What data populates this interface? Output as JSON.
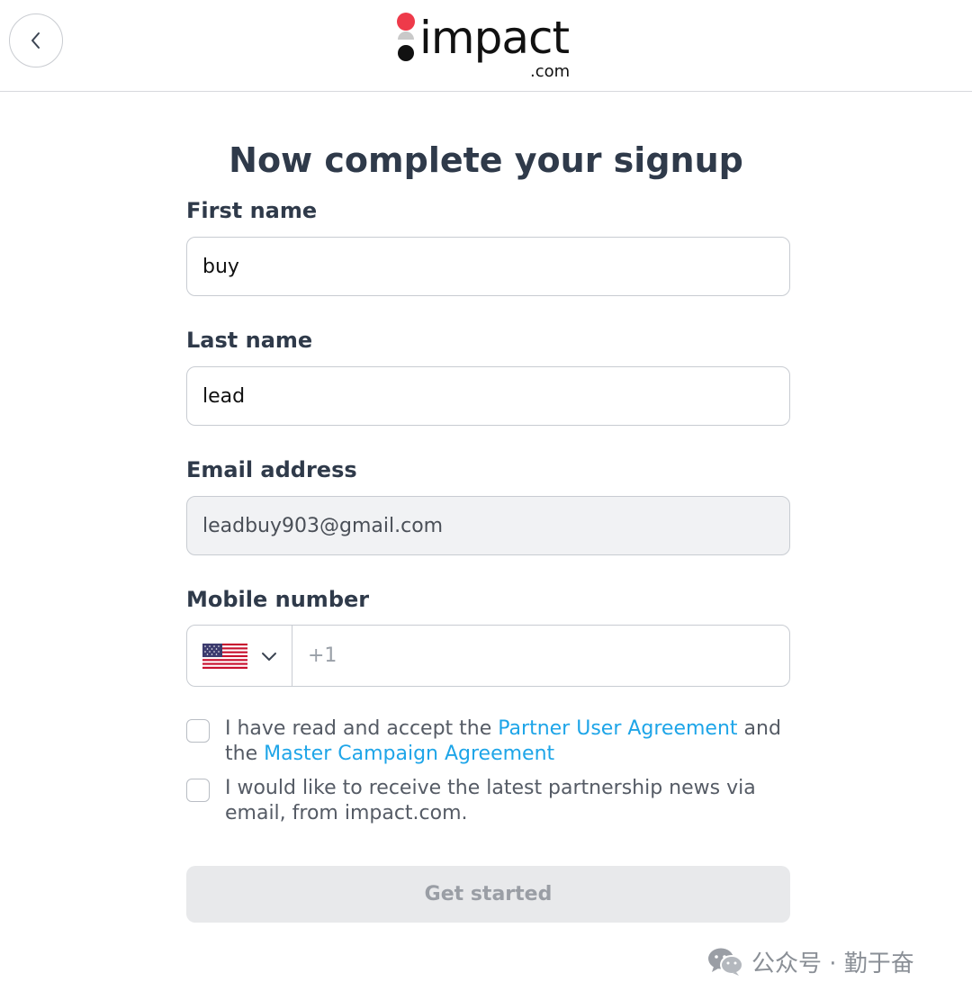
{
  "header": {
    "back_button_icon": "chevron-left-icon",
    "logo": {
      "word": "impact",
      "domain": ".com",
      "dot_colors": [
        "#ee3a4a",
        "#111111"
      ]
    }
  },
  "form": {
    "title": "Now complete your signup",
    "first_name": {
      "label": "First name",
      "value": "buy"
    },
    "last_name": {
      "label": "Last name",
      "value": "lead"
    },
    "email": {
      "label": "Email address",
      "value": "leadbuy903@gmail.com",
      "disabled": true
    },
    "mobile": {
      "label": "Mobile number",
      "country_icon": "us-flag-icon",
      "dropdown_icon": "chevron-down-icon",
      "placeholder": "+1"
    },
    "consent_terms": {
      "prefix": " I have read and accept the ",
      "link1": "Partner User Agreement",
      "middle": " and the ",
      "link2": "Master Campaign Agreement"
    },
    "consent_news": {
      "text": " I would like to receive the latest partnership news via email, from impact.com."
    },
    "submit_label": "Get started"
  },
  "colors": {
    "text": "#2f3a4a",
    "link": "#1ea5e8",
    "button_disabled_bg": "#e8e9eb",
    "button_disabled_text": "#9a9ea5"
  },
  "watermark": {
    "icon": "wechat-icon",
    "text": "公众号 · 勤于奋"
  }
}
